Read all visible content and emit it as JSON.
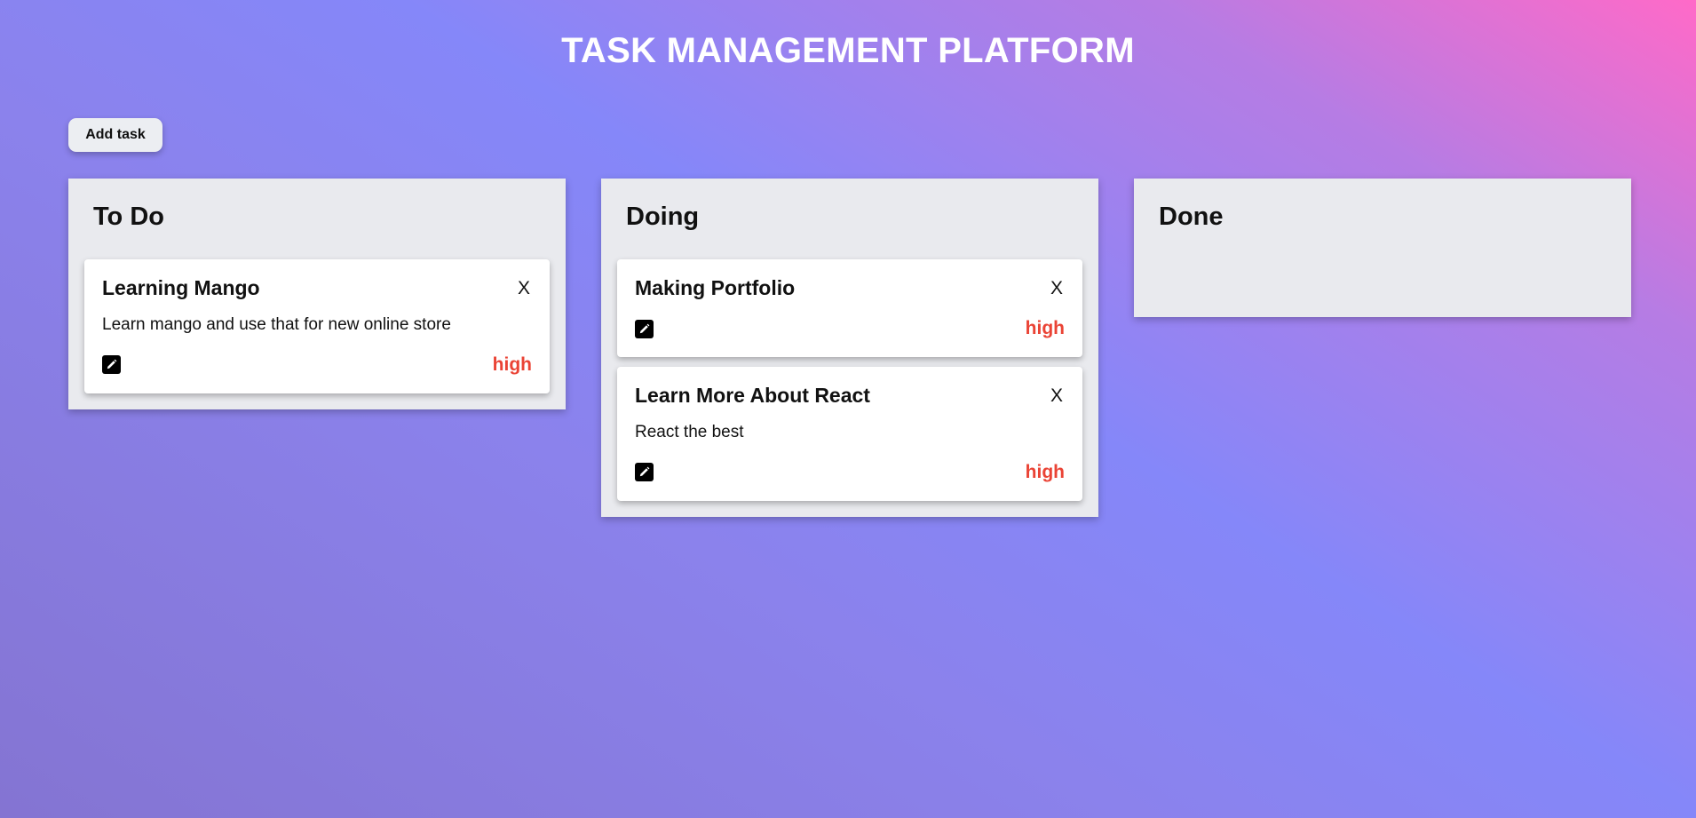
{
  "header": {
    "title": "TASK MANAGEMENT PLATFORM"
  },
  "toolbar": {
    "add_task_label": "Add task"
  },
  "colors": {
    "priority_high": "#ea4335",
    "title": "#ffffff"
  },
  "columns": [
    {
      "title": "To Do",
      "cards": [
        {
          "title": "Learning Mango",
          "description": "Learn mango and use that for new online store",
          "close_label": "X",
          "priority": "high",
          "edit_icon": "edit-icon"
        }
      ]
    },
    {
      "title": "Doing",
      "cards": [
        {
          "title": "Making Portfolio",
          "description": "",
          "close_label": "X",
          "priority": "high",
          "edit_icon": "edit-icon"
        },
        {
          "title": "Learn More About React",
          "description": "React the best",
          "close_label": "X",
          "priority": "high",
          "edit_icon": "edit-icon"
        }
      ]
    },
    {
      "title": "Done",
      "cards": []
    }
  ]
}
